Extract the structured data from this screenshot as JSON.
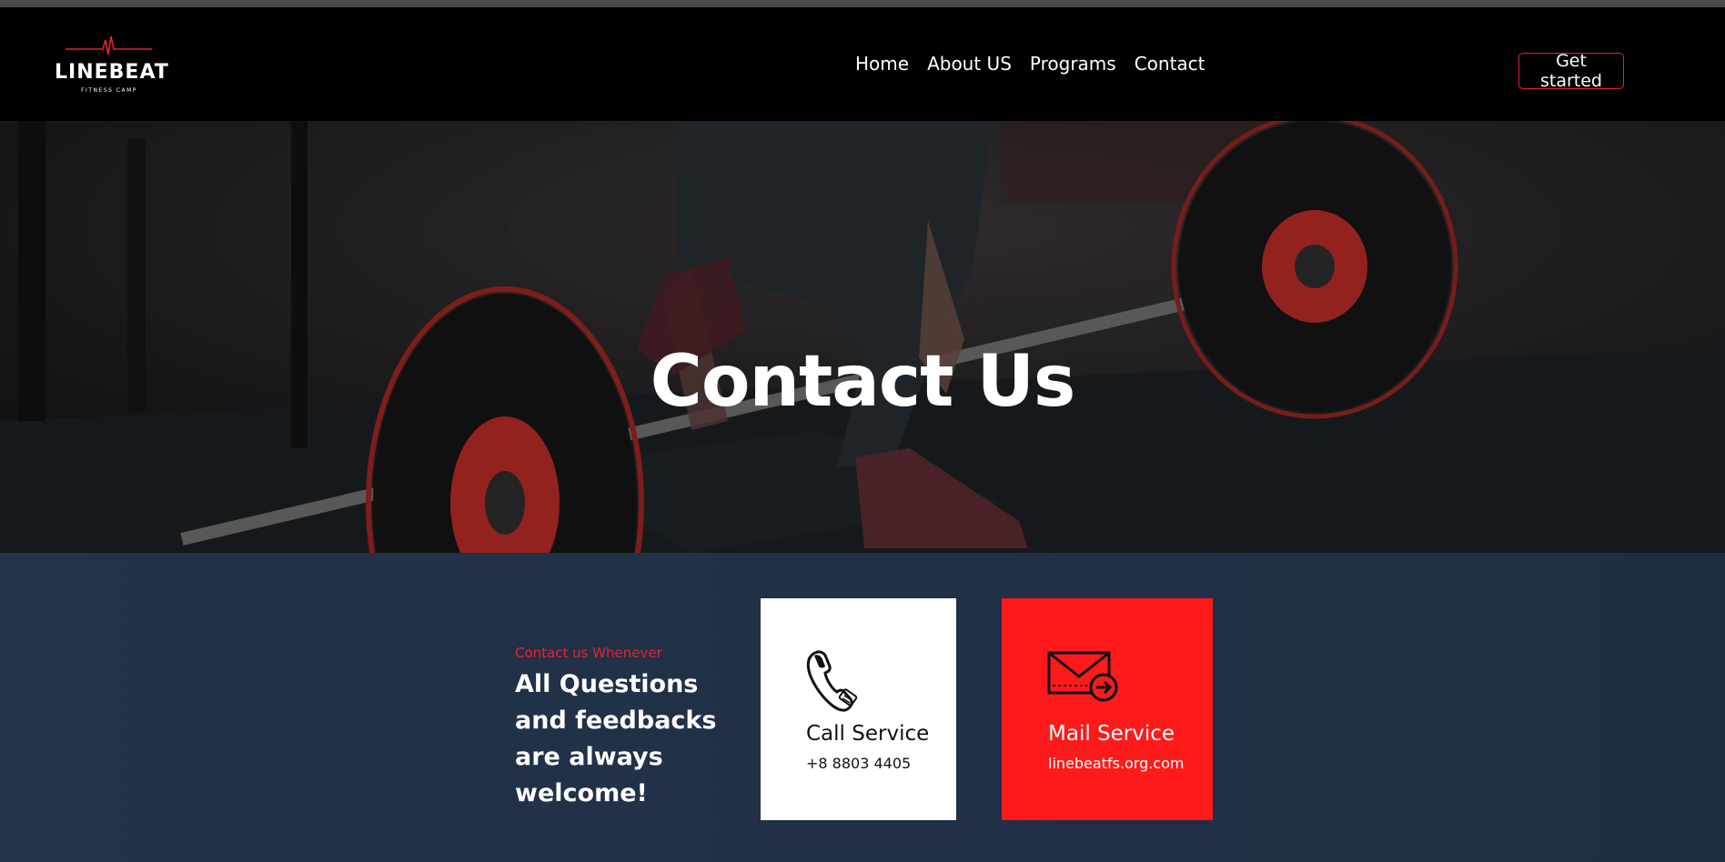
{
  "brand": {
    "name": "LINEBEAT",
    "tagline": "FITNESS CAMP",
    "accent": "#e8222b"
  },
  "nav": {
    "items": [
      {
        "label": "Home"
      },
      {
        "label": "About US"
      },
      {
        "label": "Programs"
      },
      {
        "label": "Contact"
      }
    ],
    "cta_label": "Get started"
  },
  "hero": {
    "title": "Contact Us",
    "background": "dark gym photo of a person lifting a barbell"
  },
  "contact": {
    "kicker": "Contact us Whenever",
    "headline": "All Questions and feedbacks are always welcome!",
    "cards": [
      {
        "icon": "phone-icon",
        "title": "Call Service",
        "value": "+8 8803 4405",
        "background": "#ffffff"
      },
      {
        "icon": "mail-icon",
        "title": "Mail Service",
        "value": "linebeatfs.org.com",
        "background": "#fe1a1a"
      }
    ]
  }
}
